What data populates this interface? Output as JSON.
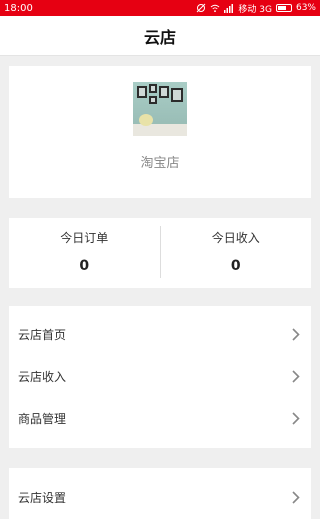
{
  "status_bar": {
    "time": "18:00",
    "carrier": "移动 3G",
    "battery": "63%"
  },
  "header": {
    "title": "云店"
  },
  "store": {
    "name": "淘宝店"
  },
  "stats": [
    {
      "label": "今日订单",
      "value": "0"
    },
    {
      "label": "今日收入",
      "value": "0"
    }
  ],
  "menu_group_1": [
    {
      "label": "云店首页"
    },
    {
      "label": "云店收入"
    },
    {
      "label": "商品管理"
    }
  ],
  "menu_group_2": [
    {
      "label": "云店设置"
    }
  ],
  "colors": {
    "status_bar": "#e60012"
  }
}
